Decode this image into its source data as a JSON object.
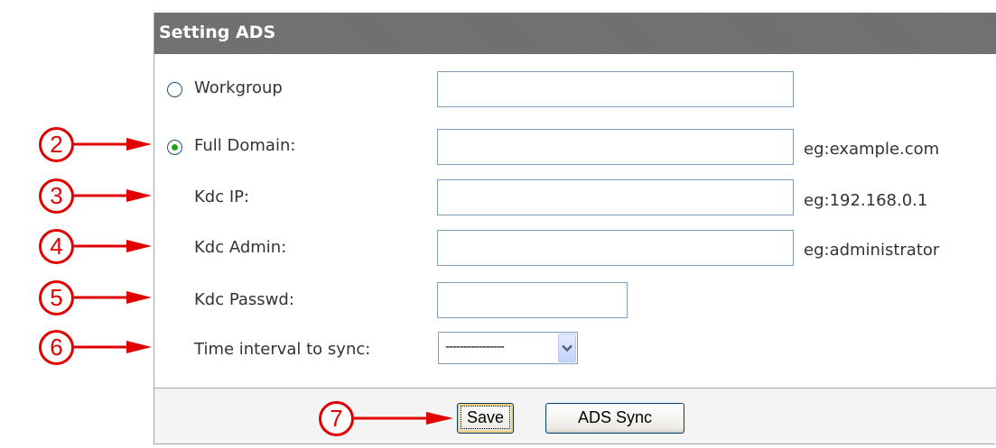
{
  "header": {
    "title": "Setting ADS"
  },
  "form": {
    "workgroup": {
      "label": "Workgroup",
      "selected": false,
      "value": ""
    },
    "full_domain": {
      "label": "Full Domain:",
      "selected": true,
      "value": "",
      "hint": "eg:example.com"
    },
    "kdc_ip": {
      "label": "Kdc IP:",
      "value": "",
      "hint": "eg:192.168.0.1"
    },
    "kdc_admin": {
      "label": "Kdc Admin:",
      "value": "",
      "hint": "eg:administrator"
    },
    "kdc_passwd": {
      "label": "Kdc Passwd:",
      "value": ""
    },
    "sync_interval": {
      "label": "Time interval to sync:",
      "selected": "----------------"
    }
  },
  "buttons": {
    "save": "Save",
    "ads_sync": "ADS Sync"
  },
  "callouts": [
    "2",
    "3",
    "4",
    "5",
    "6",
    "7"
  ],
  "colors": {
    "header_bg": "#6e6e6e",
    "callout": "#e00000",
    "radio_dot": "#21a121",
    "input_border": "#7f9db9"
  },
  "icons": {
    "select_arrow": "chevron-down-icon",
    "callout_arrow": "right-arrow-icon"
  }
}
